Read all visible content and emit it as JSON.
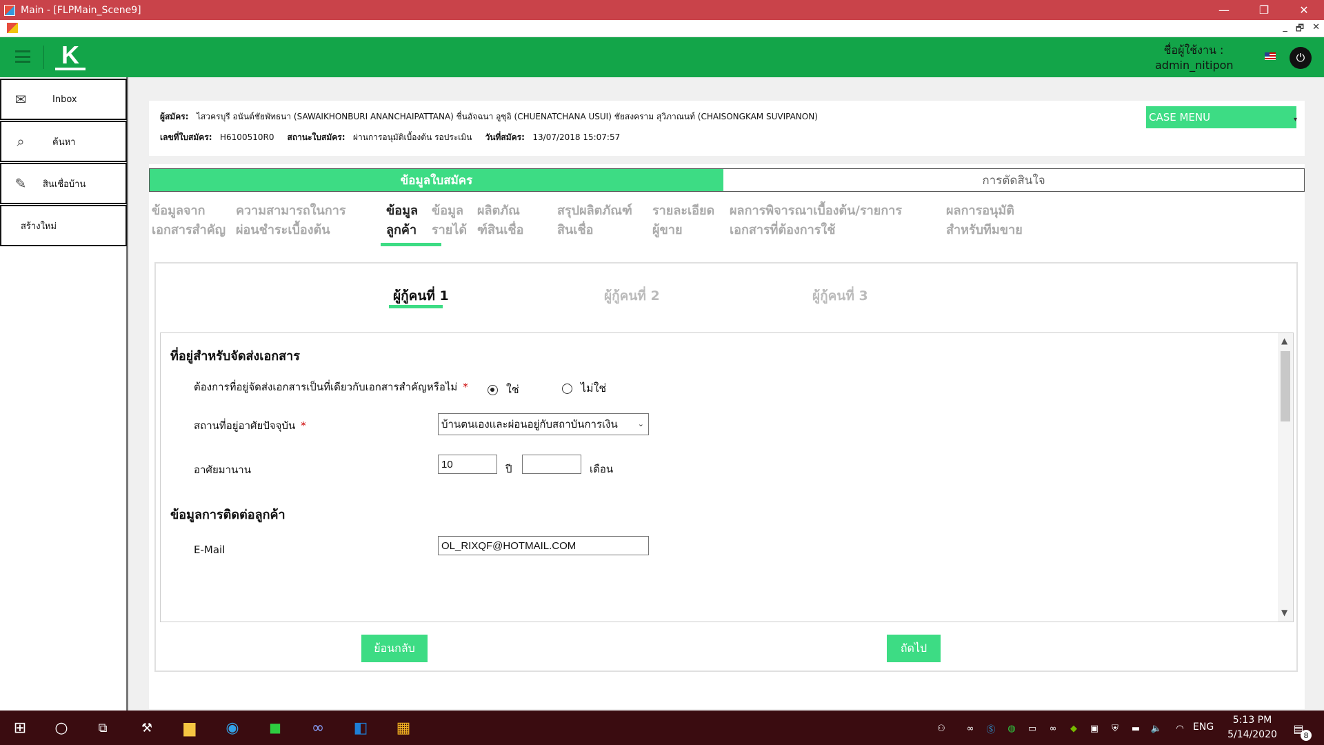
{
  "window": {
    "title": "Main - [FLPMain_Scene9]",
    "minimize": "—",
    "restore": "❐",
    "close": "✕",
    "mdi_min": "_",
    "mdi_restore": "🗗",
    "mdi_close": "✕"
  },
  "header": {
    "logo_text": "K",
    "user_label": "ชื่อผู้ใช้งาน :",
    "username": "admin_nitipon",
    "logout_icon": "⏻"
  },
  "sidebar": {
    "items": [
      {
        "label": "Inbox",
        "icon": "mail-icon",
        "glyph": "✉"
      },
      {
        "label": "ค้นหา",
        "icon": "search-icon",
        "glyph": "⌕"
      },
      {
        "label": "สินเชื่อบ้าน",
        "icon": "edit-document-icon",
        "glyph": "✎"
      },
      {
        "label": "สร้างใหม่",
        "icon": "",
        "glyph": ""
      }
    ]
  },
  "case_info": {
    "applicant_label": "ผู้สมัคร:",
    "applicant_value": "ไสวครบุรี อนันต์ชัยพัทธนา (SAWAIKHONBURI ANANCHAIPATTANA) ชื่นอัจฉนา อูซุอิ (CHUENATCHANA USUI) ชัยสงคราม สุวิภาณนท์ (CHAISONGKAM SUVIPANON)",
    "app_no_label": "เลขที่ใบสมัคร:",
    "app_no_value": "H6100510R0",
    "status_label": "สถานะใบสมัคร:",
    "status_value": "ผ่านการอนุมัติเบื้องต้น รอประเมิน",
    "date_label": "วันที่สมัคร:",
    "date_value": "13/07/2018 15:07:57",
    "case_menu": "CASE MENU",
    "case_menu_caret": "▾"
  },
  "top_tabs": {
    "active": "ข้อมูลใบสมัคร",
    "inactive": "การตัดสินใจ"
  },
  "sub_tabs": [
    {
      "line1": "ข้อมูลจาก",
      "line2": "เอกสารสำคัญ"
    },
    {
      "line1": "ความสามารถในการ",
      "line2": "ผ่อนชำระเบื้องต้น"
    },
    {
      "line1": "ข้อมูล",
      "line2": "ลูกค้า"
    },
    {
      "line1": "ข้อมูล",
      "line2": "รายได้"
    },
    {
      "line1": "ผลิตภัณ",
      "line2": "ฑ์สินเชื่อ"
    },
    {
      "line1": "สรุปผลิตภัณฑ์",
      "line2": "สินเชื่อ"
    },
    {
      "line1": "รายละเอียด",
      "line2": "ผู้ขาย"
    },
    {
      "line1": "ผลการพิจารณาเบื้องต้น/รายการ",
      "line2": "เอกสารที่ต้องการใช้"
    },
    {
      "line1": "ผลการอนุมัติ",
      "line2": "สำหรับทีมขาย"
    }
  ],
  "guarantor_tabs": [
    "ผู้กู้คนที่ 1",
    "ผู้กู้คนที่ 2",
    "ผู้กู้คนที่ 3"
  ],
  "form": {
    "section1_title": "ที่อยู่สำหรับจัดส่งเอกสาร",
    "q_same_address": "ต้องการที่อยู่จัดส่งเอกสารเป็นที่เดียวกับเอกสารสำคัญหรือไม่",
    "required_mark": "*",
    "radio_yes": "ใช่",
    "radio_no": "ไม่ใช่",
    "residence_label": "สถานที่อยู่อาศัยปัจจุบัน",
    "residence_value": "บ้านตนเองและผ่อนอยู่กับสถาบันการเงิน",
    "stay_label": "อาศัยมานาน",
    "stay_years": "10",
    "years_unit": "ปี",
    "stay_months": "",
    "months_unit": "เดือน",
    "section2_title": "ข้อมูลการติดต่อลูกค้า",
    "email_label": "E-Mail",
    "email_value": "OL_RIXQF@HOTMAIL.COM",
    "scroll_up": "▲",
    "scroll_down": "▼"
  },
  "buttons": {
    "back": "ย้อนกลับ",
    "next": "ถัดไป"
  },
  "taskbar": {
    "start_glyph": "⊞",
    "search_glyph": "○",
    "lang": "ENG",
    "time": "5:13 PM",
    "date": "5/14/2020",
    "notifications": "8"
  }
}
